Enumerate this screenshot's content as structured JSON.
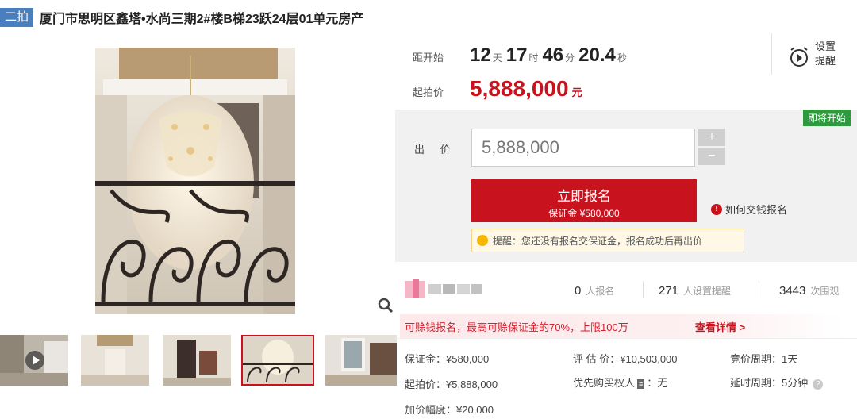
{
  "title": {
    "round_badge": "二拍",
    "text": "厦门市思明区鑫塔•水尚三期2#楼B梯23跃24层01单元房产"
  },
  "countdown": {
    "label": "距开始",
    "days": "12",
    "days_unit": "天",
    "hours": "17",
    "hours_unit": "时",
    "minutes": "46",
    "minutes_unit": "分",
    "seconds": "20.4",
    "seconds_unit": "秒"
  },
  "reminder": {
    "label_line1": "设置",
    "label_line2": "提醒"
  },
  "start_price": {
    "label": "起拍价",
    "value": "5,888,000",
    "unit": "元"
  },
  "bid": {
    "status_badge": "即将开始",
    "label": "出 价",
    "input_value": "5,888,000",
    "plus": "+",
    "minus": "−",
    "enroll_label": "立即报名",
    "enroll_sub": "保证金 ¥580,000",
    "howto": "如何交钱报名",
    "tip": "提醒：您还没有报名交保证金，报名成功后再出价"
  },
  "stats": {
    "enrolled_count": "0",
    "enrolled_label": "人报名",
    "reminders_count": "271",
    "reminders_label": "人设置提醒",
    "views_count": "3443",
    "views_label": "次围观"
  },
  "loan": {
    "text": "可赊钱报名，最高可赊保证金的70%，上限100万",
    "link": "查看详情 >"
  },
  "info": {
    "deposit": "保证金：¥580,000",
    "appraisal": "评 估 价：¥10,503,000",
    "period": "竞价周期：1天",
    "start_price": "起拍价：¥5,888,000",
    "priority_label": "优先购买权人",
    "priority_value": "：无",
    "delay": "延时周期：5分钟",
    "increment": "加价幅度：¥20,000"
  },
  "colors": {
    "accent": "#c8121d",
    "badge_blue": "#4a7fbf",
    "status_green": "#2e9a3e"
  }
}
